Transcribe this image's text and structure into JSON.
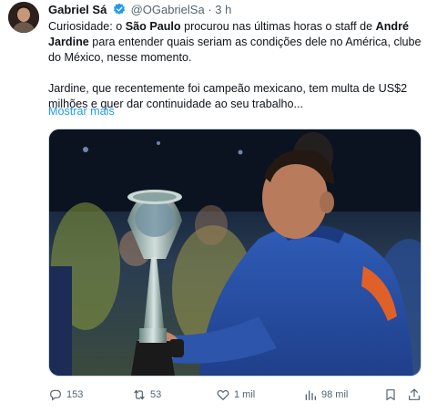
{
  "author": {
    "name": "Gabriel Sá",
    "handle": "@OGabrielSa",
    "separator": "·",
    "time": "3 h"
  },
  "tweet": {
    "p1": {
      "t1": "Curiosidade: o ",
      "b1": "São Paulo",
      "t2": " procurou nas últimas horas o staff de ",
      "b2": "André Jardine",
      "t3": " para entender quais seriam as condições dele no América, clube do México, nesse momento."
    },
    "p2": "Jardine, que recentemente foi campeão mexicano, tem multa de US$2 milhões e quer dar continuidade ao seu trabalho...",
    "show_more": "Mostrar mais"
  },
  "actions": {
    "replies": "153",
    "retweets": "53",
    "likes": "1 mil",
    "views": "98 mil"
  },
  "icons": [
    "verified-badge-icon",
    "reply-icon",
    "retweet-icon",
    "like-icon",
    "views-icon",
    "bookmark-icon",
    "share-icon"
  ],
  "colors": {
    "accent": "#1d9bf0",
    "muted": "#536471",
    "text": "#0f1419"
  }
}
